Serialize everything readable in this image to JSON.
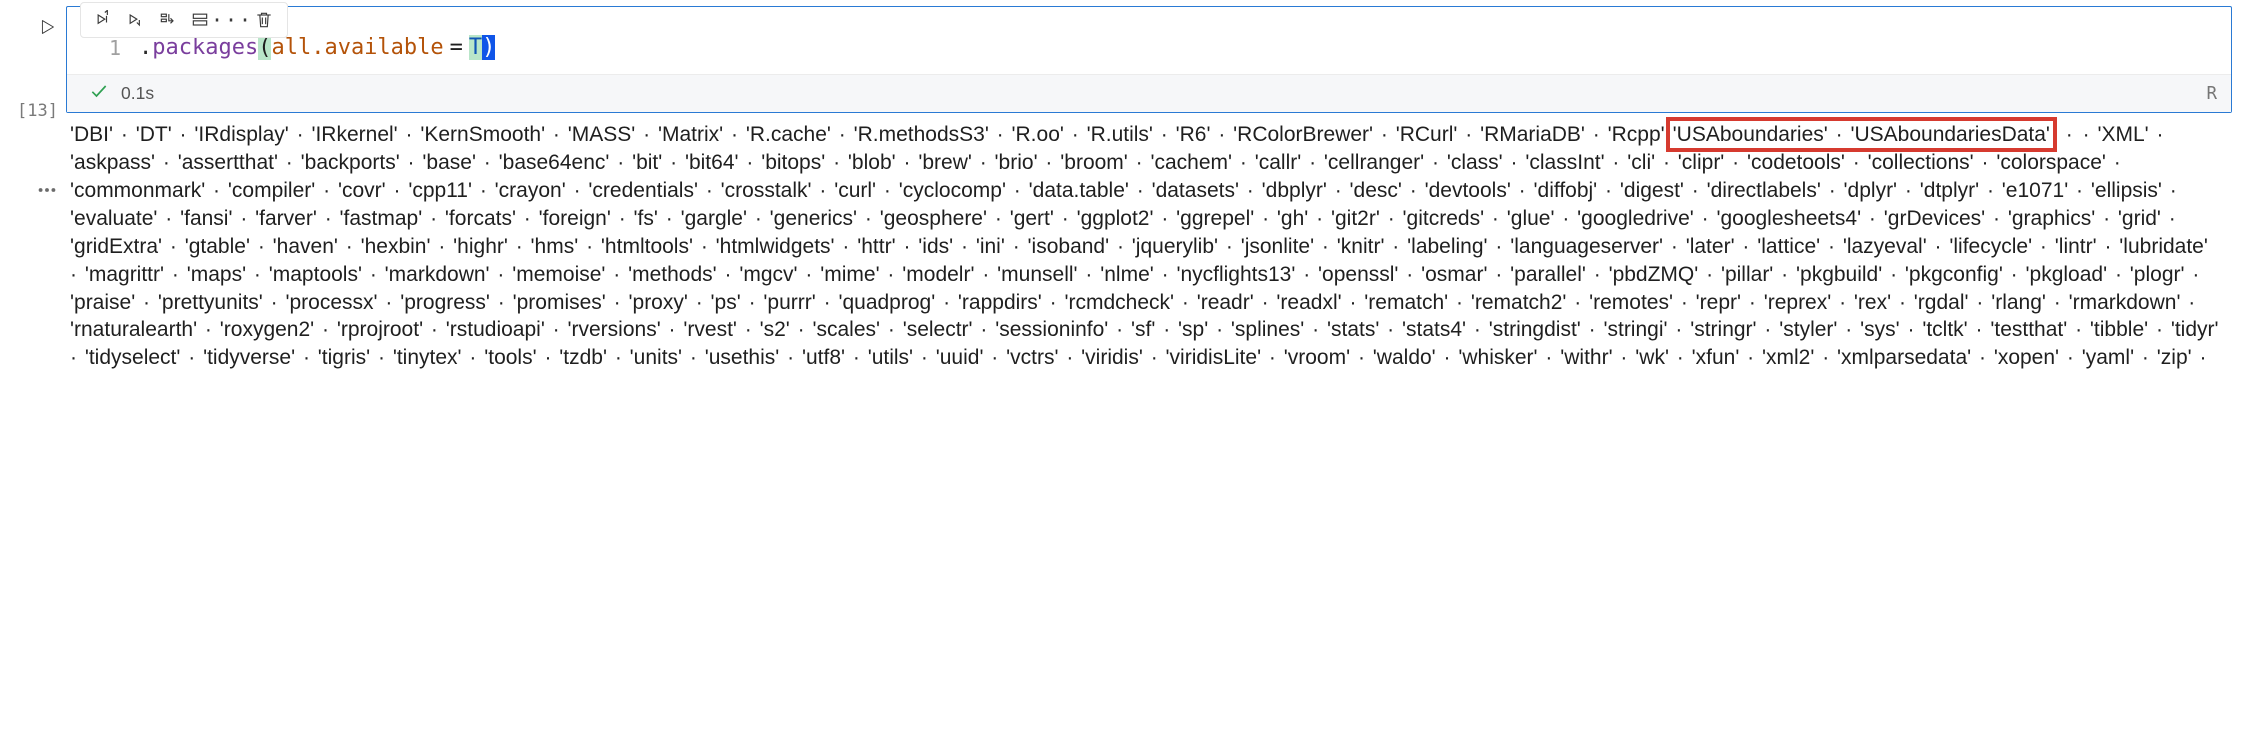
{
  "cell": {
    "exec_count_label": "[13]",
    "line_number": "1",
    "code_tokens": {
      "dot": ".",
      "fn": "packages",
      "open_paren": "(",
      "arg_name": "all.available",
      "eq": "=",
      "const": "T",
      "close_paren": ")"
    },
    "status": {
      "time": "0.1s",
      "lang": "R"
    }
  },
  "output": {
    "separator": "·",
    "highlight": [
      "USAboundaries",
      "USAboundariesData"
    ],
    "packages": [
      "DBI",
      "DT",
      "IRdisplay",
      "IRkernel",
      "KernSmooth",
      "MASS",
      "Matrix",
      "R.cache",
      "R.methodsS3",
      "R.oo",
      "R.utils",
      "R6",
      "RColorBrewer",
      "RCurl",
      "RMariaDB",
      "Rcpp",
      "USAboundaries",
      "USAboundariesData",
      "XML",
      "askpass",
      "assertthat",
      "backports",
      "base",
      "base64enc",
      "bit",
      "bit64",
      "bitops",
      "blob",
      "brew",
      "brio",
      "broom",
      "cachem",
      "callr",
      "cellranger",
      "class",
      "classInt",
      "cli",
      "clipr",
      "codetools",
      "collections",
      "colorspace",
      "commonmark",
      "compiler",
      "covr",
      "cpp11",
      "crayon",
      "credentials",
      "crosstalk",
      "curl",
      "cyclocomp",
      "data.table",
      "datasets",
      "dbplyr",
      "desc",
      "devtools",
      "diffobj",
      "digest",
      "directlabels",
      "dplyr",
      "dtplyr",
      "e1071",
      "ellipsis",
      "evaluate",
      "fansi",
      "farver",
      "fastmap",
      "forcats",
      "foreign",
      "fs",
      "gargle",
      "generics",
      "geosphere",
      "gert",
      "ggplot2",
      "ggrepel",
      "gh",
      "git2r",
      "gitcreds",
      "glue",
      "googledrive",
      "googlesheets4",
      "grDevices",
      "graphics",
      "grid",
      "gridExtra",
      "gtable",
      "haven",
      "hexbin",
      "highr",
      "hms",
      "htmltools",
      "htmlwidgets",
      "httr",
      "ids",
      "ini",
      "isoband",
      "jquerylib",
      "jsonlite",
      "knitr",
      "labeling",
      "languageserver",
      "later",
      "lattice",
      "lazyeval",
      "lifecycle",
      "lintr",
      "lubridate",
      "magrittr",
      "maps",
      "maptools",
      "markdown",
      "memoise",
      "methods",
      "mgcv",
      "mime",
      "modelr",
      "munsell",
      "nlme",
      "nycflights13",
      "openssl",
      "osmar",
      "parallel",
      "pbdZMQ",
      "pillar",
      "pkgbuild",
      "pkgconfig",
      "pkgload",
      "plogr",
      "praise",
      "prettyunits",
      "processx",
      "progress",
      "promises",
      "proxy",
      "ps",
      "purrr",
      "quadprog",
      "rappdirs",
      "rcmdcheck",
      "readr",
      "readxl",
      "rematch",
      "rematch2",
      "remotes",
      "repr",
      "reprex",
      "rex",
      "rgdal",
      "rlang",
      "rmarkdown",
      "rnaturalearth",
      "roxygen2",
      "rprojroot",
      "rstudioapi",
      "rversions",
      "rvest",
      "s2",
      "scales",
      "selectr",
      "sessioninfo",
      "sf",
      "sp",
      "splines",
      "stats",
      "stats4",
      "stringdist",
      "stringi",
      "stringr",
      "styler",
      "sys",
      "tcltk",
      "testthat",
      "tibble",
      "tidyr",
      "tidyselect",
      "tidyverse",
      "tigris",
      "tinytex",
      "tools",
      "tzdb",
      "units",
      "usethis",
      "utf8",
      "utils",
      "uuid",
      "vctrs",
      "viridis",
      "viridisLite",
      "vroom",
      "waldo",
      "whisker",
      "withr",
      "wk",
      "xfun",
      "xml2",
      "xmlparsedata",
      "xopen",
      "yaml",
      "zip"
    ]
  }
}
